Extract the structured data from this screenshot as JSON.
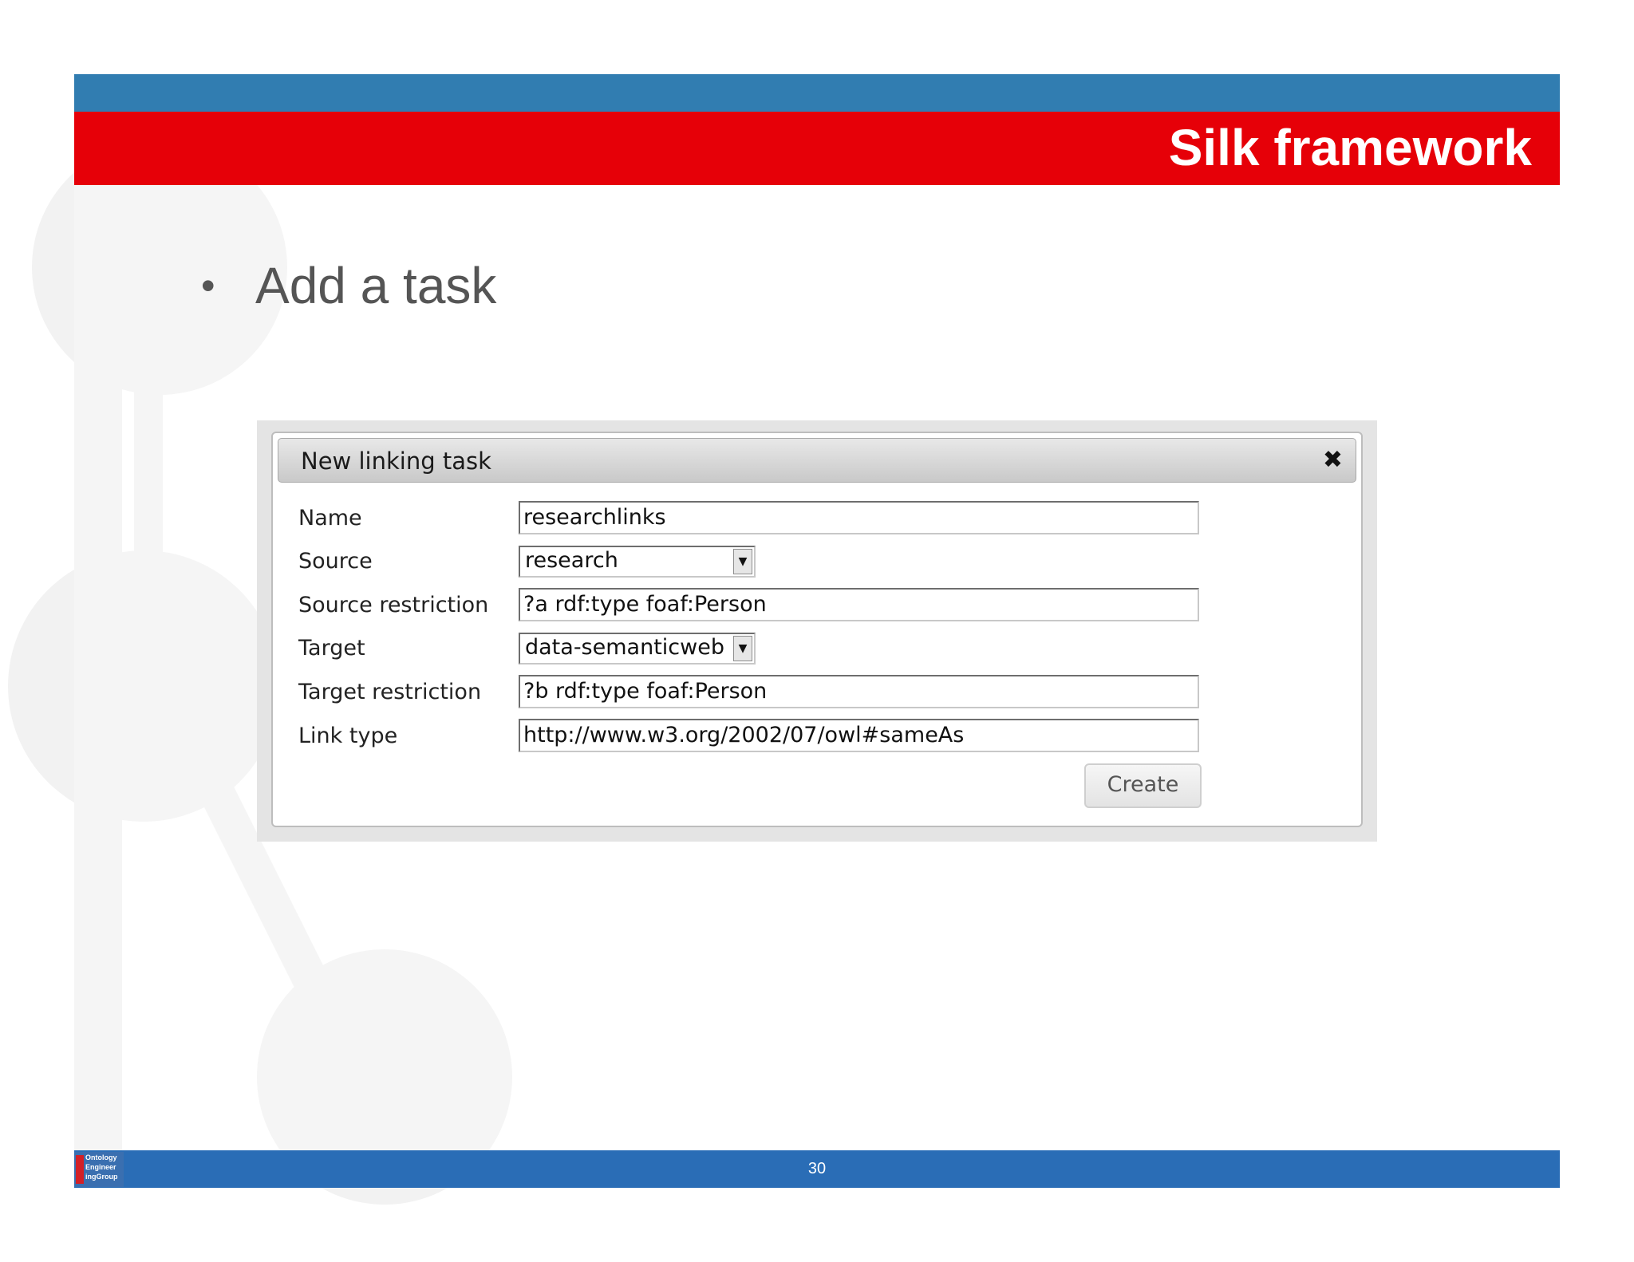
{
  "slide": {
    "title": "Silk framework",
    "bullet": "Add a task",
    "page_number": "30"
  },
  "logo": {
    "text": "Ontology\nEngineer\ningGroup"
  },
  "dialog": {
    "title": "New linking task",
    "close_icon": "close-icon",
    "fields": [
      {
        "label": "Name",
        "value": "researchlinks",
        "type": "text"
      },
      {
        "label": "Source",
        "value": "research",
        "type": "select"
      },
      {
        "label": "Source restriction",
        "value": "?a rdf:type foaf:Person",
        "type": "text"
      },
      {
        "label": "Target",
        "value": "data-semanticweb",
        "type": "select"
      },
      {
        "label": "Target restriction",
        "value": "?b rdf:type foaf:Person",
        "type": "text"
      },
      {
        "label": "Link type",
        "value": "http://www.w3.org/2002/07/owl#sameAs",
        "type": "text"
      }
    ],
    "create_label": "Create"
  },
  "colors": {
    "header_blue": "#317DB1",
    "header_red": "#E60008",
    "footer_blue": "#2A6DB6"
  }
}
